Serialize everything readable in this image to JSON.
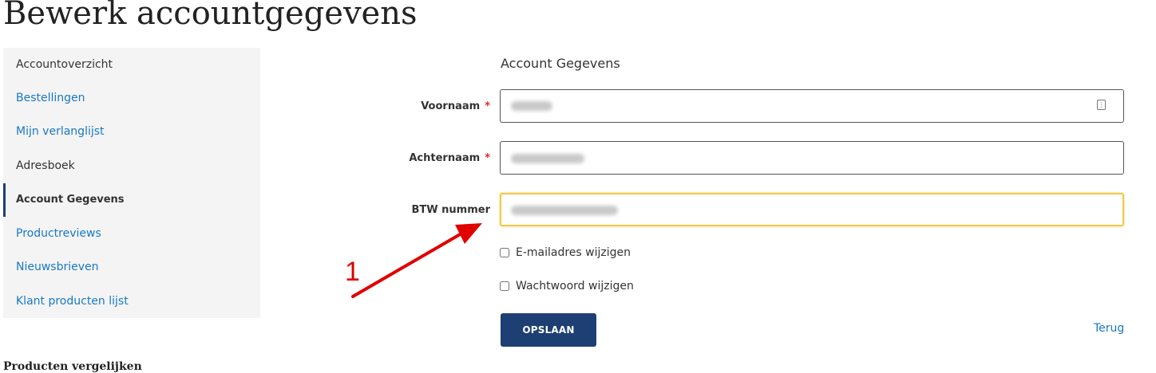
{
  "page": {
    "title": "Bewerk accountgegevens"
  },
  "sidebar": {
    "items": [
      {
        "label": "Accountoverzicht"
      },
      {
        "label": "Bestellingen"
      },
      {
        "label": "Mijn verlanglijst"
      },
      {
        "label": "Adresboek"
      },
      {
        "label": "Account Gegevens",
        "active": true
      },
      {
        "label": "Productreviews"
      },
      {
        "label": "Nieuwsbrieven"
      },
      {
        "label": "Klant producten lijst"
      }
    ]
  },
  "form": {
    "section_title": "Account Gegevens",
    "required_mark": "*",
    "fields": {
      "first_name": {
        "label": "Voornaam"
      },
      "last_name": {
        "label": "Achternaam"
      },
      "vat": {
        "label": "BTW nummer"
      }
    },
    "checkboxes": {
      "change_email": {
        "label": "E-mailadres wijzigen",
        "checked": false
      },
      "change_password": {
        "label": "Wachtwoord wijzigen",
        "checked": false
      }
    },
    "save_label": "OPSLAAN",
    "back_label": "Terug"
  },
  "footer": {
    "compare_title": "Producten vergelijken"
  },
  "annotation": {
    "number": "1",
    "color": "#e00000"
  },
  "colors": {
    "accent": "#1e3f73",
    "link": "#1979c3",
    "required": "#e02b27",
    "focus": "#f2c94c"
  },
  "icons": {
    "autofill": "contact-card-icon",
    "arrow": "red-arrow-icon"
  }
}
